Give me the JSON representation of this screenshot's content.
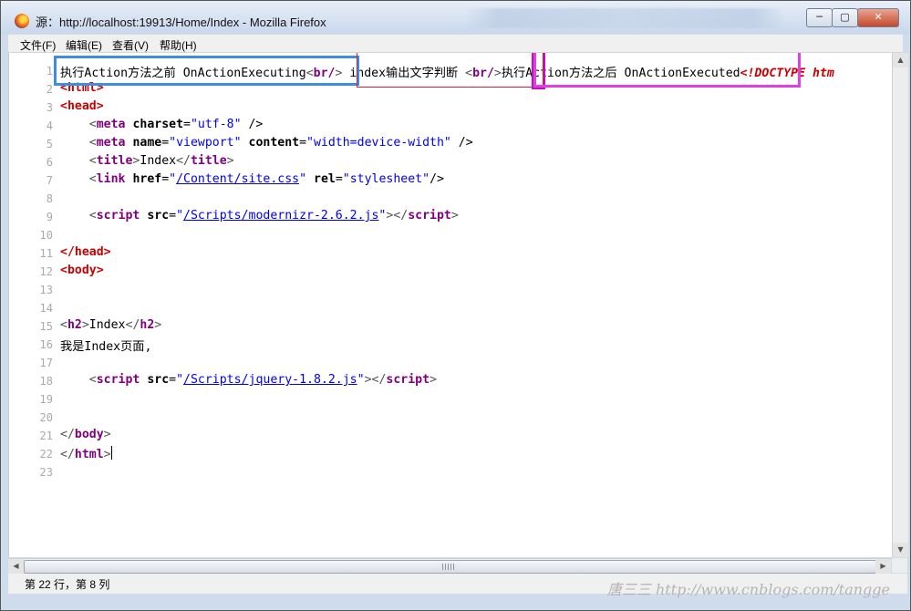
{
  "window": {
    "title": "源：http://localhost:19913/Home/Index - Mozilla Firefox",
    "buttons": {
      "minimize": "─",
      "maximize": "▢",
      "close": "✕"
    }
  },
  "menu": [
    "文件(F)",
    "编辑(E)",
    "查看(V)",
    "帮助(H)"
  ],
  "editor": {
    "line_numbers": [
      "1",
      "2",
      "3",
      "4",
      "5",
      "6",
      "7",
      "8",
      "9",
      "10",
      "11",
      "12",
      "13",
      "14",
      "15",
      "16",
      "17",
      "18",
      "19",
      "20",
      "21",
      "22",
      "23"
    ],
    "line1": {
      "text_a": "执行Action方法之前 OnActionExecuting",
      "br1": "br/",
      "text_b": " index输出文字判断 ",
      "br2": "br/",
      "text_c": "执行Action方法之后 OnActionExecuted",
      "doctype": "!DOCTYPE htm"
    },
    "tags": {
      "html": "html",
      "head": "head",
      "meta": "meta",
      "title": "title",
      "link": "link",
      "script": "script",
      "body": "body",
      "h2": "h2"
    },
    "attrs": {
      "charset": "charset",
      "name": "name",
      "content": "content",
      "href": "href",
      "rel": "rel",
      "src": "src"
    },
    "values": {
      "charset": "\"utf-8\"",
      "name": "\"viewport\"",
      "content": "\"width=device-width\"",
      "href": "/Content/site.css",
      "rel": "\"stylesheet\"",
      "src1": "/Scripts/modernizr-2.6.2.js",
      "src2": "/Scripts/jquery-1.8.2.js"
    },
    "texts": {
      "title": "Index",
      "h2": "Index",
      "line16": "我是Index页面,"
    }
  },
  "statusbar": {
    "position": "第 22 行，第 8 列"
  },
  "watermark": "唐三三 http://www.cnblogs.com/tangge"
}
